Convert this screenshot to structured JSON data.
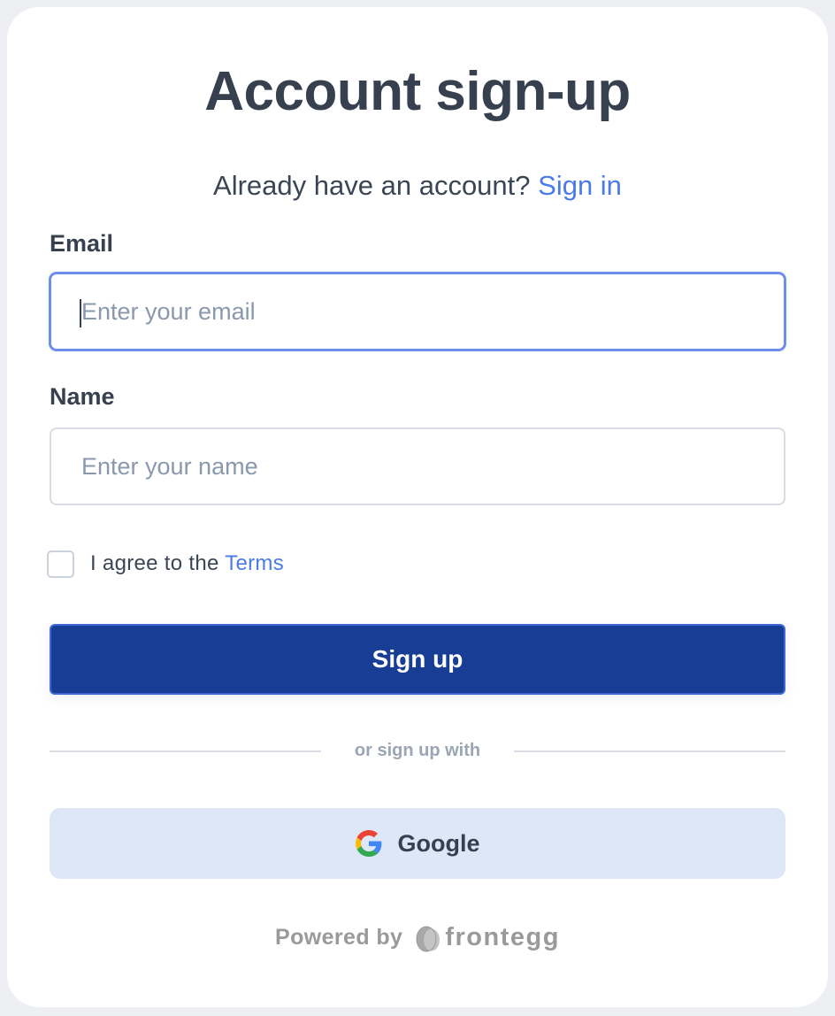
{
  "header": {
    "title": "Account sign-up",
    "subtitle_text": "Already have an account?",
    "signin_link": "Sign in"
  },
  "form": {
    "email": {
      "label": "Email",
      "placeholder": "Enter your email",
      "value": ""
    },
    "name": {
      "label": "Name",
      "placeholder": "Enter your name",
      "value": ""
    },
    "terms": {
      "checked": false,
      "text": "I agree to the",
      "link": "Terms"
    },
    "submit_label": "Sign up"
  },
  "social": {
    "divider_text": "or sign up with",
    "google_label": "Google",
    "google_icon": "google-g-icon"
  },
  "footer": {
    "powered_by": "Powered by",
    "brand_name": "frontegg",
    "brand_icon": "frontegg-egg-icon"
  },
  "colors": {
    "primary": "#183d94",
    "link": "#4a7be8",
    "focus": "#6d8ee8",
    "google_bg": "#dde7f5"
  }
}
